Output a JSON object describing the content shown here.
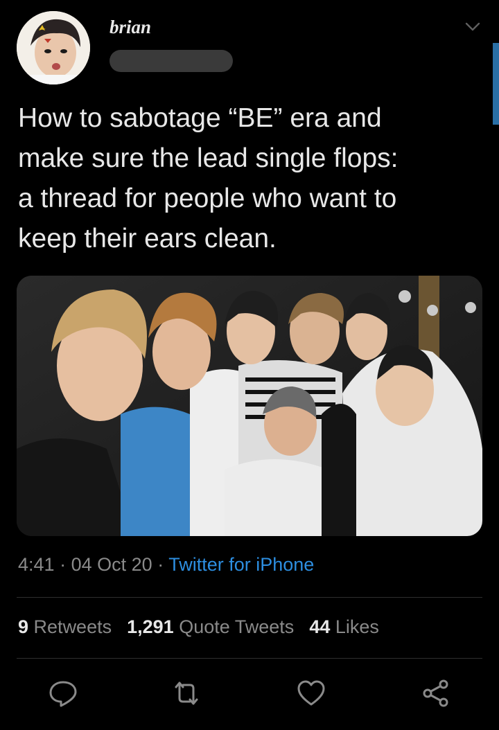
{
  "author": {
    "display_name": "brian"
  },
  "tweet": {
    "text_lines": [
      "How to sabotage “BE” era and",
      "make sure the lead single flops:",
      "a thread for people who want to",
      "keep their ears clean."
    ]
  },
  "meta": {
    "time": "4:41",
    "separator": "·",
    "date": "04 Oct 20",
    "source": "Twitter for iPhone"
  },
  "stats": {
    "retweets_count": "9",
    "retweets_label": "Retweets",
    "quote_count": "1,291",
    "quote_label": "Quote Tweets",
    "likes_count": "44",
    "likes_label": "Likes"
  },
  "actions": [
    "reply-icon",
    "retweet-icon",
    "like-icon",
    "share-icon"
  ],
  "colors": {
    "background": "#000000",
    "link": "#2d8ee0",
    "muted": "#8a8a8a",
    "divider": "#2f2f2f",
    "scrollbar": "#2a6fa6"
  }
}
